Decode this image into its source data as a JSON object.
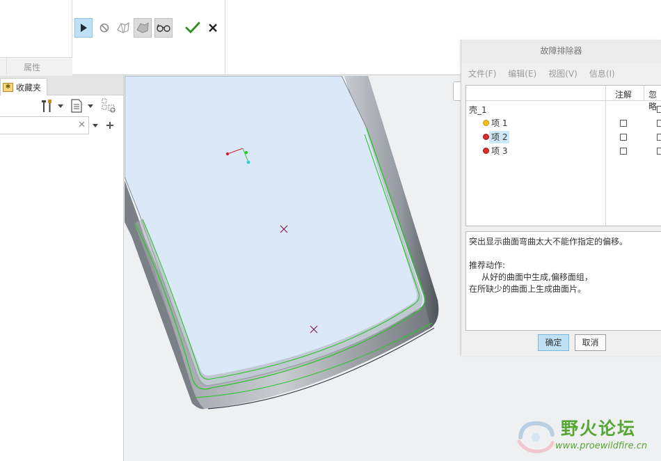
{
  "ribbon": {
    "group_label": "属性"
  },
  "left_panel": {
    "tab_label": "收藏夹"
  },
  "dialog": {
    "title": "故障排除器",
    "menu": [
      "文件(F)",
      "编辑(E)",
      "视图(V)",
      "信息(I)"
    ],
    "columns": {
      "annotate": "注解",
      "ignore": "忽略"
    },
    "root": "壳_1",
    "items": [
      {
        "label": "项 1",
        "status": "warning",
        "color": "#f2c21b"
      },
      {
        "label": "项 2",
        "status": "error",
        "color": "#d62d2d",
        "selected": true
      },
      {
        "label": "项 3",
        "status": "error",
        "color": "#d62d2d"
      }
    ],
    "message": {
      "line1": "突出显示曲面弯曲太大不能作指定的偏移。",
      "heading": "推荐动作:",
      "line2": "从好的曲面中生成,偏移面组，",
      "line3": "在所缺少的曲面上生成曲面片。"
    },
    "ok_label": "确定",
    "cancel_label": "取消"
  },
  "watermark": {
    "name": "野火论坛",
    "url": "www.proewildfire.cn"
  }
}
